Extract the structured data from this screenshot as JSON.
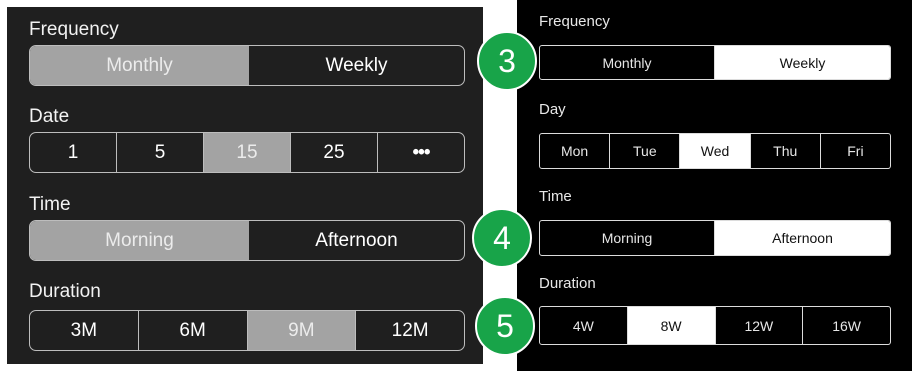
{
  "left": {
    "frequency": {
      "label": "Frequency",
      "options": [
        "Monthly",
        "Weekly"
      ],
      "selected": "Monthly"
    },
    "date": {
      "label": "Date",
      "options": [
        "1",
        "5",
        "15",
        "25",
        "•••"
      ],
      "selected": "15"
    },
    "time": {
      "label": "Time",
      "options": [
        "Morning",
        "Afternoon"
      ],
      "selected": "Morning"
    },
    "duration": {
      "label": "Duration",
      "options": [
        "3M",
        "6M",
        "9M",
        "12M"
      ],
      "selected": "9M"
    }
  },
  "right": {
    "frequency": {
      "label": "Frequency",
      "options": [
        "Monthly",
        "Weekly"
      ],
      "selected": "Weekly"
    },
    "day": {
      "label": "Day",
      "options": [
        "Mon",
        "Tue",
        "Wed",
        "Thu",
        "Fri"
      ],
      "selected": "Wed"
    },
    "time": {
      "label": "Time",
      "options": [
        "Morning",
        "Afternoon"
      ],
      "selected": "Afternoon"
    },
    "duration": {
      "label": "Duration",
      "options": [
        "4W",
        "8W",
        "12W",
        "16W"
      ],
      "selected": "8W"
    }
  },
  "badges": [
    "3",
    "4",
    "5"
  ],
  "colors": {
    "badge": "#18a449",
    "left_selected": "#a3a3a3",
    "right_selected": "#ffffff",
    "left_bg": "#1f1f1f",
    "right_bg": "#000000"
  }
}
